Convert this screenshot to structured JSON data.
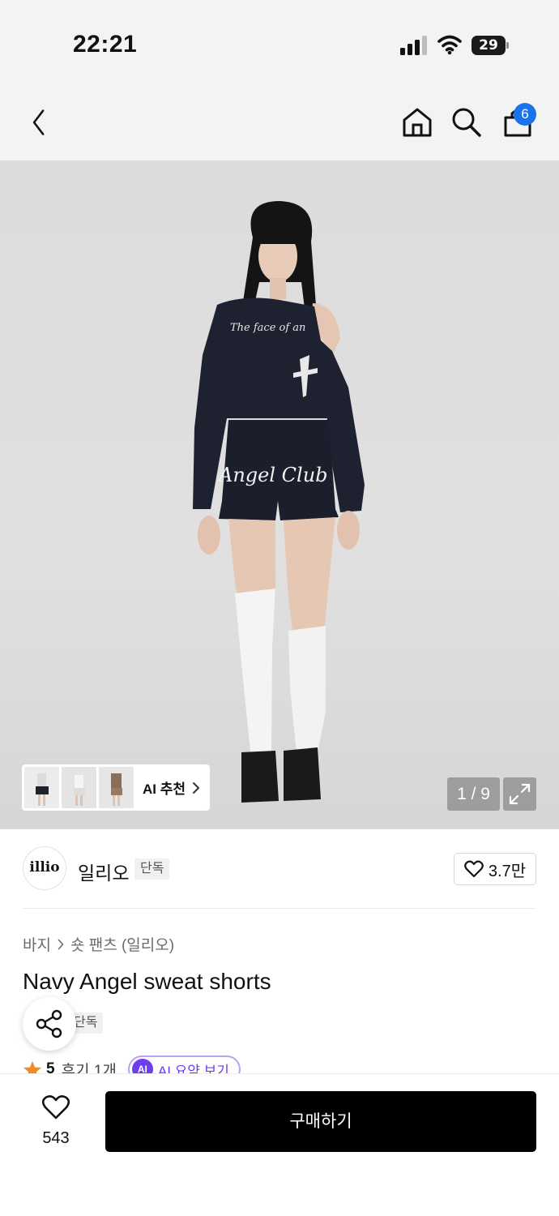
{
  "status_bar": {
    "time": "22:21",
    "battery": "29",
    "icons": [
      "cellular-signal-icon",
      "wifi-icon",
      "battery-icon"
    ]
  },
  "nav": {
    "icons": [
      "back-icon",
      "home-icon",
      "search-icon",
      "cart-icon"
    ],
    "cart_badge": "6"
  },
  "gallery": {
    "ai_recommend_label": "AI 추천",
    "counter": "1 / 9",
    "expand_icon": "expand-icon"
  },
  "brand": {
    "logo_text": "illio",
    "name": "일리오",
    "tag": "단독",
    "likes": "3.7만"
  },
  "product": {
    "breadcrumb": [
      "바지",
      "숏 팬츠 (일리오)"
    ],
    "title": "Navy Angel sweat shorts",
    "tag": "단독",
    "rating": "5",
    "review_count": "후기 1개",
    "ai_summary_badge": "AI",
    "ai_summary_label": "AI 요약 보기"
  },
  "bottom_bar": {
    "wish_count": "543",
    "buy_label": "구매하기"
  },
  "colors": {
    "accent_blue": "#1a73e8",
    "ai_purple": "#6f3df0",
    "star": "#f08a24",
    "buy_button": "#000000"
  }
}
